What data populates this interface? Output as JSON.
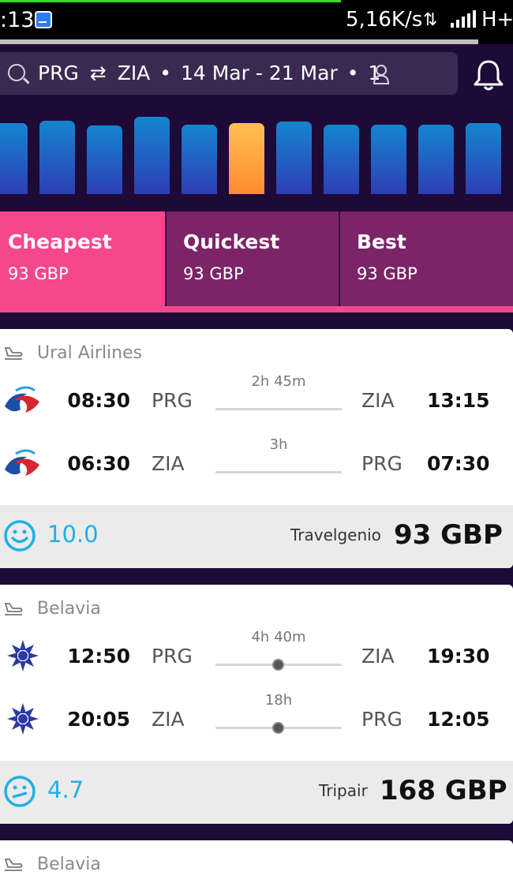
{
  "status_bar": {
    "time": ":13",
    "speed": "5,16K/s",
    "network": "H+",
    "data_arrows": "⇅"
  },
  "search": {
    "origin": "PRG",
    "swap": "⇄",
    "destination": "ZIA",
    "dates": "14 Mar - 21 Mar",
    "passengers": "1",
    "sep1": "•",
    "sep2": "•"
  },
  "price_bars": {
    "selected_index": 5,
    "levels": [
      0.85,
      0.88,
      0.82,
      0.92,
      0.83,
      0.85,
      0.87,
      0.83,
      0.83,
      0.83,
      0.85
    ],
    "colors": {
      "bar_top": "#1585cf",
      "bar_bottom": "#2d3eb5",
      "selected_top": "#ffbf55",
      "selected_bottom": "#ff8c32"
    }
  },
  "sort_tabs": [
    {
      "label": "Cheapest",
      "price": "93 GBP",
      "active": true
    },
    {
      "label": "Quickest",
      "price": "93 GBP",
      "active": false
    },
    {
      "label": "Best",
      "price": "93 GBP",
      "active": false
    }
  ],
  "results": [
    {
      "airline": "Ural Airlines",
      "logo": "ural-airlines-logo",
      "legs": [
        {
          "dep_time": "08:30",
          "dep_code": "PRG",
          "duration": "2h 45m",
          "stops": 0,
          "arr_code": "ZIA",
          "arr_time": "13:15"
        },
        {
          "dep_time": "06:30",
          "dep_code": "ZIA",
          "duration": "3h",
          "stops": 0,
          "arr_code": "PRG",
          "arr_time": "07:30"
        }
      ],
      "score": "10.0",
      "score_mood": "happy",
      "provider": "Travelgenio",
      "price": "93 GBP"
    },
    {
      "airline": "Belavia",
      "logo": "belavia-logo",
      "legs": [
        {
          "dep_time": "12:50",
          "dep_code": "PRG",
          "duration": "4h 40m",
          "stops": 1,
          "arr_code": "ZIA",
          "arr_time": "19:30"
        },
        {
          "dep_time": "20:05",
          "dep_code": "ZIA",
          "duration": "18h",
          "stops": 1,
          "arr_code": "PRG",
          "arr_time": "12:05"
        }
      ],
      "score": "4.7",
      "score_mood": "neutral",
      "provider": "Tripair",
      "price": "168 GBP"
    },
    {
      "airline": "Belavia"
    }
  ],
  "colors": {
    "accent_pink": "#f5478e",
    "tab_purple": "#7b2467",
    "background": "#1d0a36",
    "score_blue": "#1fb0e6"
  }
}
